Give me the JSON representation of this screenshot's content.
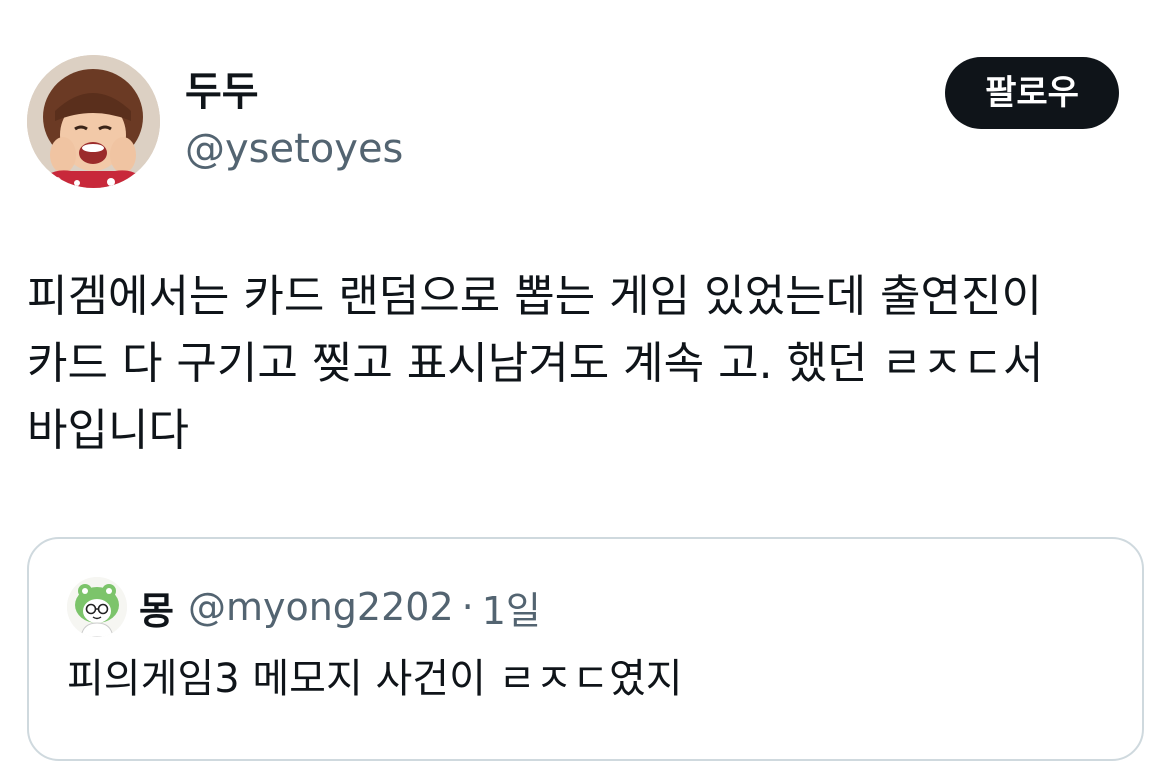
{
  "tweet": {
    "author": {
      "display_name": "두두",
      "handle": "@ysetoyes"
    },
    "follow_label": "팔로우",
    "text_lines": [
      "피겜에서는 카드 랜덤으로 뽑는 게임 있었는데 출연진이",
      "카드 다 구기고 찢고 표시남겨도 계속 고. 했던 ㄹㅈㄷ서",
      "바입니다"
    ]
  },
  "quote": {
    "author": {
      "display_name": "몽",
      "handle": "@myong2202"
    },
    "separator": "·",
    "time": "1일",
    "text": "피의게임3 메모지 사건이 ㄹㅈㄷ였지"
  },
  "colors": {
    "text_primary": "#0f1419",
    "text_secondary": "#536471",
    "follow_bg": "#0f1419",
    "card_border": "#cfd9de"
  }
}
